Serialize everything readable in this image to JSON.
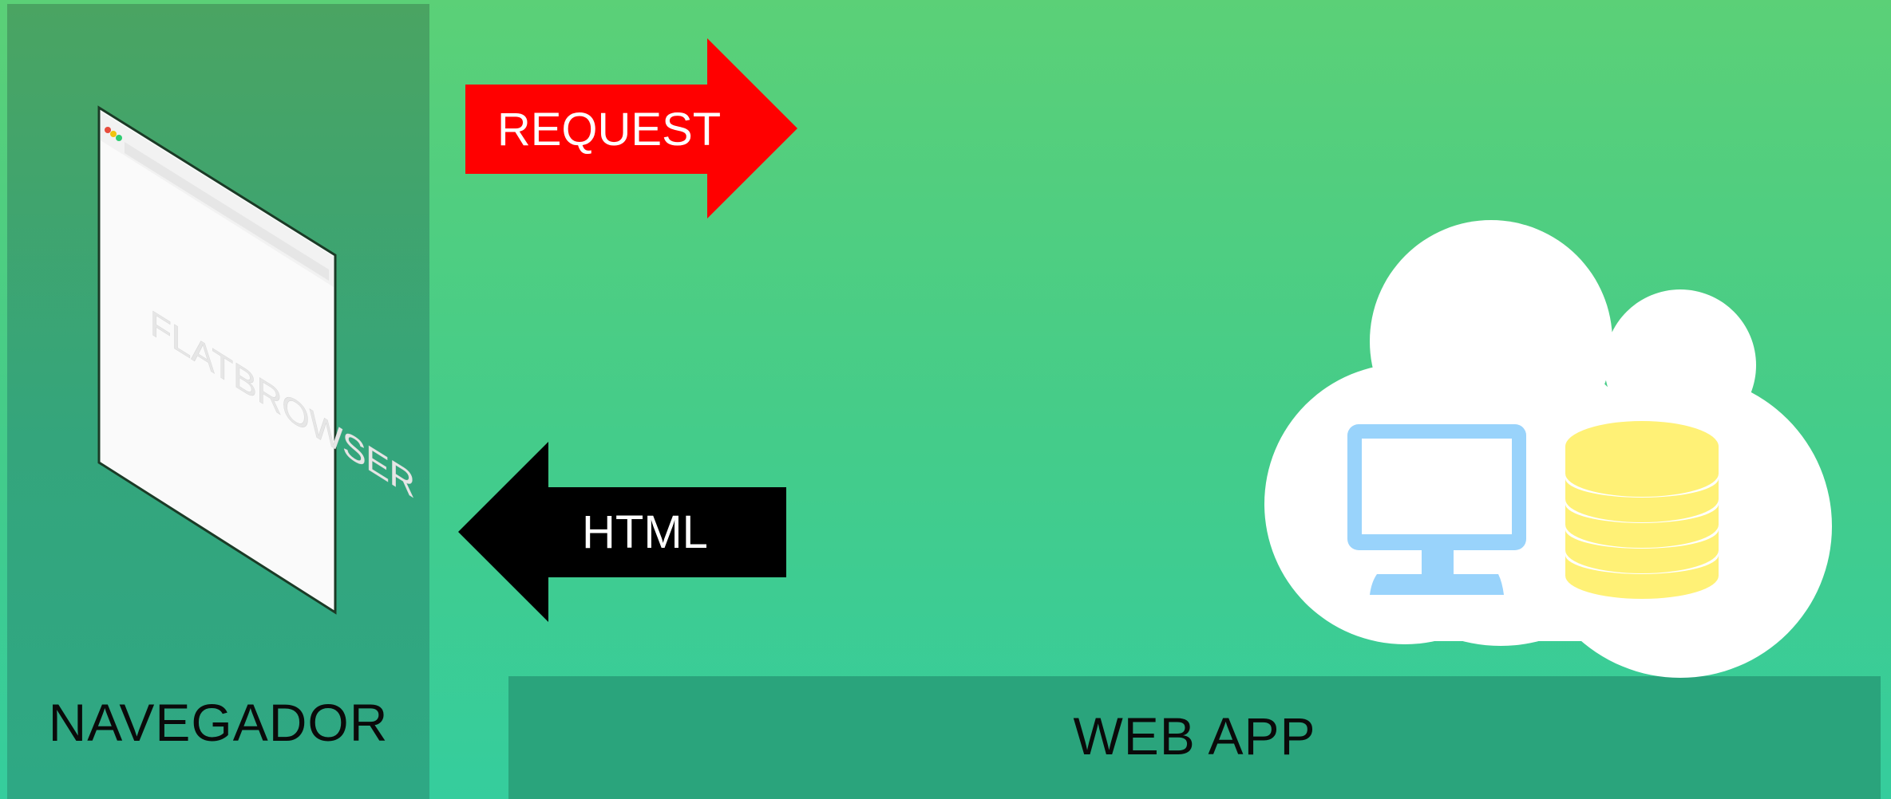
{
  "diagram": {
    "browser_panel": {
      "label": "NAVEGADOR",
      "browser_watermark": "FLATBROWSER"
    },
    "request_arrow": {
      "label": "REQUEST",
      "color": "#ff0000",
      "direction": "right"
    },
    "response_arrow": {
      "label": "HTML",
      "color": "#000000",
      "direction": "left"
    },
    "server": {
      "label": "WEB APP",
      "cloud_icon": "cloud-icon",
      "monitor_icon": "monitor-icon",
      "database_icon": "database-icon"
    },
    "colors": {
      "background_top": "#5bd077",
      "background_bottom": "#35cd9d",
      "panel": "#34a57c",
      "monitor": "#99d3fb",
      "database": "#fff176"
    }
  }
}
